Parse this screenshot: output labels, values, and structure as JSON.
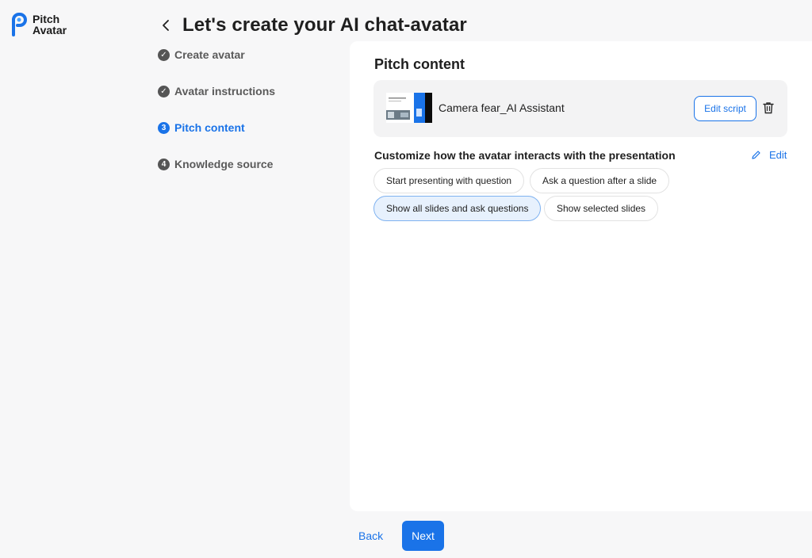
{
  "brand": {
    "line1": "Pitch",
    "line2": "Avatar",
    "logo_icon": "pitch-avatar-logo",
    "accent": "#1a73e8"
  },
  "header": {
    "title": "Let's create your AI chat-avatar",
    "back_icon": "chevron-left-icon"
  },
  "steps": [
    {
      "label": "Create avatar",
      "state": "done",
      "marker": "✓"
    },
    {
      "label": "Avatar instructions",
      "state": "done",
      "marker": "✓"
    },
    {
      "label": "Pitch content",
      "state": "active",
      "marker": "3"
    },
    {
      "label": "Knowledge source",
      "state": "pending",
      "marker": "4"
    }
  ],
  "panel": {
    "title": "Pitch content",
    "presentation": {
      "name": "Camera fear_AI Assistant",
      "edit_script_label": "Edit script",
      "delete_icon": "trash-icon"
    },
    "customize_label": "Customize how the avatar interacts with the presentation",
    "edit_label": "Edit",
    "edit_icon": "pencil-icon",
    "options": [
      {
        "label": "Start presenting with question",
        "selected": false
      },
      {
        "label": "Ask a question after a slide",
        "selected": false
      },
      {
        "label": "Show all slides and ask questions",
        "selected": true
      },
      {
        "label": "Show selected slides",
        "selected": false
      }
    ]
  },
  "footer": {
    "back_label": "Back",
    "next_label": "Next"
  }
}
